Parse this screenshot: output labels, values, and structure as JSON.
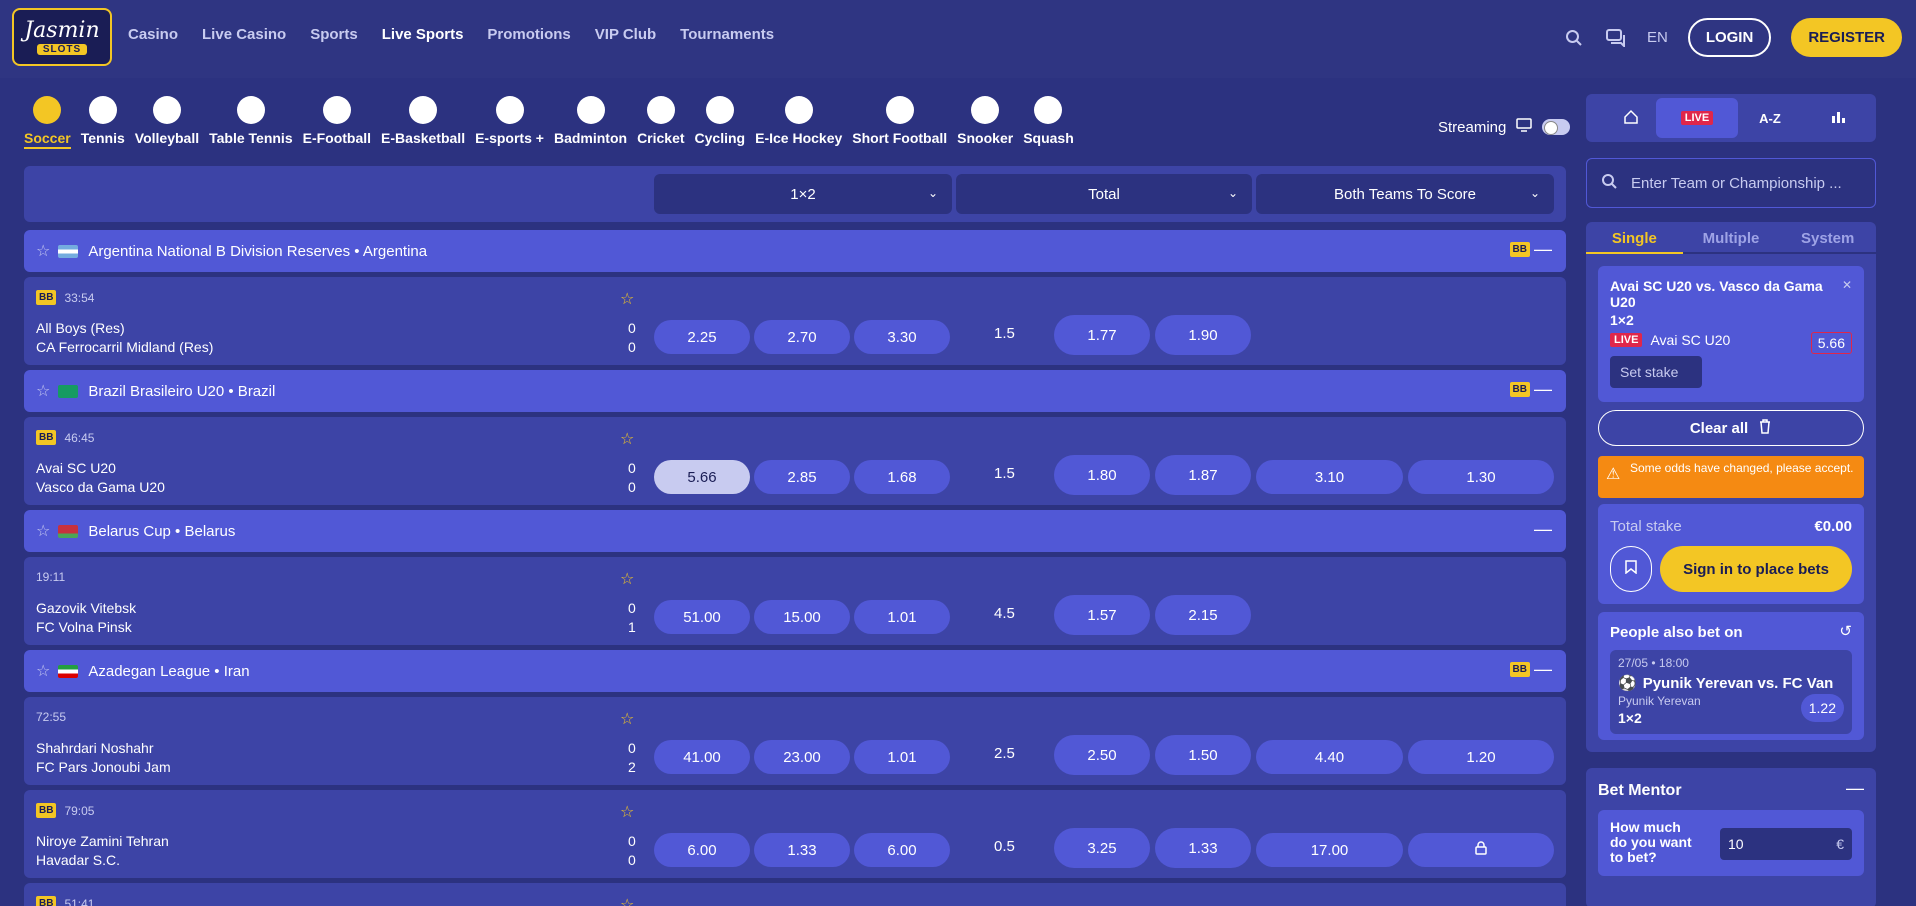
{
  "header": {
    "logo_text": "Jasmin",
    "logo_sub": "SLOTS",
    "nav": [
      "Casino",
      "Live Casino",
      "Sports",
      "Live Sports",
      "Promotions",
      "VIP Club",
      "Tournaments"
    ],
    "active_nav": "Live Sports",
    "lang": "EN",
    "login": "LOGIN",
    "register": "REGISTER"
  },
  "sports": [
    "Soccer",
    "Tennis",
    "Volleyball",
    "Table Tennis",
    "E-Football",
    "E-Basketball",
    "E-sports +",
    "Badminton",
    "Cricket",
    "Cycling",
    "E-Ice Hockey",
    "Short Football",
    "Snooker",
    "Squash"
  ],
  "active_sport": "Soccer",
  "streaming": "Streaming",
  "markets": [
    "1×2",
    "Total",
    "Both Teams To Score"
  ],
  "leagues": [
    {
      "name": "Argentina National B Division Reserves • Argentina",
      "bb": "BB"
    },
    {
      "name": "Brazil Brasileiro U20 • Brazil",
      "bb": "BB"
    },
    {
      "name": "Belarus Cup • Belarus",
      "bb": ""
    },
    {
      "name": "Azadegan League • Iran",
      "bb": "BB"
    }
  ],
  "matches": [
    {
      "bb": "BB",
      "time": "33:54",
      "team1": "All Boys (Res)",
      "team2": "CA Ferrocarril Midland (Res)",
      "s1": "0",
      "s2": "0",
      "o1": "2.25",
      "ox": "2.70",
      "o2": "3.30",
      "line": "1.5",
      "over": "1.77",
      "under": "1.90",
      "yes": "",
      "no": ""
    },
    {
      "bb": "BB",
      "time": "46:45",
      "team1": "Avai SC U20",
      "team2": "Vasco da Gama U20",
      "s1": "0",
      "s2": "0",
      "o1": "5.66",
      "ox": "2.85",
      "o2": "1.68",
      "line": "1.5",
      "over": "1.80",
      "under": "1.87",
      "yes": "3.10",
      "no": "1.30"
    },
    {
      "bb": "",
      "time": "19:11",
      "team1": "Gazovik Vitebsk",
      "team2": "FC Volna Pinsk",
      "s1": "0",
      "s2": "1",
      "o1": "51.00",
      "ox": "15.00",
      "o2": "1.01",
      "line": "4.5",
      "over": "1.57",
      "under": "2.15",
      "yes": "",
      "no": ""
    },
    {
      "bb": "",
      "time": "72:55",
      "team1": "Shahrdari Noshahr",
      "team2": "FC Pars Jonoubi Jam",
      "s1": "0",
      "s2": "2",
      "o1": "41.00",
      "ox": "23.00",
      "o2": "1.01",
      "line": "2.5",
      "over": "2.50",
      "under": "1.50",
      "yes": "4.40",
      "no": "1.20"
    },
    {
      "bb": "BB",
      "time": "79:05",
      "team1": "Niroye Zamini Tehran",
      "team2": "Havadar S.C.",
      "s1": "0",
      "s2": "0",
      "o1": "6.00",
      "ox": "1.33",
      "o2": "6.00",
      "line": "0.5",
      "over": "3.25",
      "under": "1.33",
      "yes": "17.00",
      "no": ""
    },
    {
      "bb": "BB",
      "time": "51:41"
    }
  ],
  "right": {
    "tabs": [
      "LIVE",
      "A-Z"
    ],
    "search_placeholder": "Enter Team or Championship ...",
    "slip_tabs": [
      "Single",
      "Multiple",
      "System"
    ],
    "bet": {
      "match": "Avai SC U20 vs. Vasco da Gama U20",
      "market": "1×2",
      "live": "LIVE",
      "pick": "Avai SC U20",
      "odds": "5.66",
      "stake_placeholder": "Set stake"
    },
    "clear": "Clear all",
    "warning": "Some odds have changed, please accept.",
    "total_label": "Total stake",
    "total_value": "€0.00",
    "sign_in": "Sign in to place bets",
    "also_title": "People also bet on",
    "also": {
      "date": "27/05 • 18:00",
      "match": "Pyunik Yerevan vs. FC Van",
      "team": "Pyunik Yerevan",
      "market": "1×2",
      "odds": "1.22"
    },
    "mentor_title": "Bet Mentor",
    "mentor_q": "How much do you want to bet?",
    "mentor_val": "10",
    "mentor_cur": "€"
  }
}
